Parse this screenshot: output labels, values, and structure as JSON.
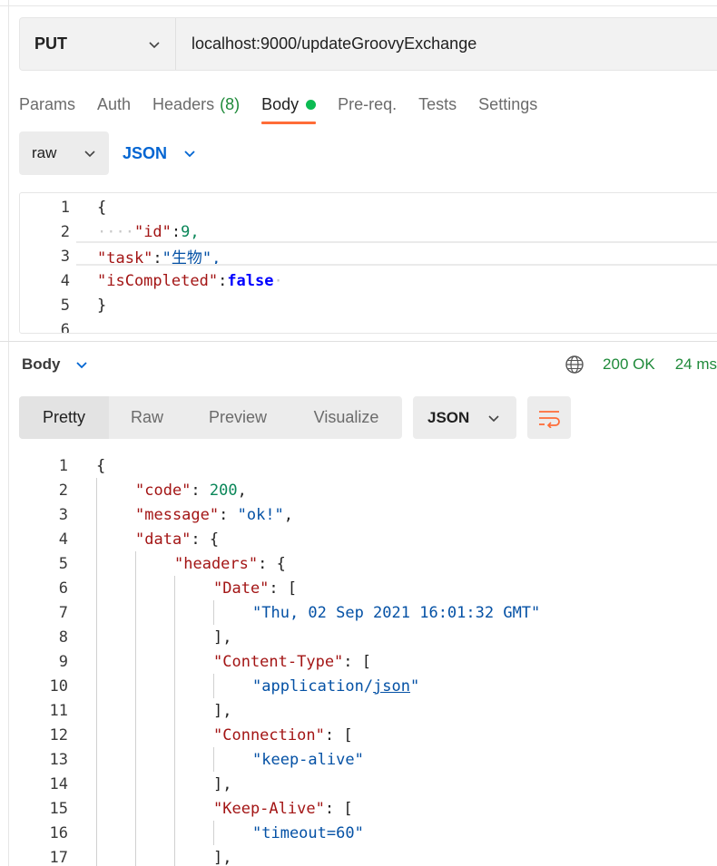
{
  "request": {
    "method": "PUT",
    "url": "localhost:9000/updateGroovyExchange",
    "tabs": [
      {
        "label": "Params"
      },
      {
        "label": "Auth"
      },
      {
        "label": "Headers",
        "count": "(8)"
      },
      {
        "label": "Body"
      },
      {
        "label": "Pre-req."
      },
      {
        "label": "Tests"
      },
      {
        "label": "Settings"
      }
    ],
    "body_mode": "raw",
    "body_format": "JSON",
    "body_lines": [
      {
        "num": "1",
        "text": "{"
      },
      {
        "num": "2",
        "key": "\"id\"",
        "value": "9,"
      },
      {
        "num": "3",
        "key": "\"task\"",
        "value": "\"生物\","
      },
      {
        "num": "4",
        "key": "\"isCompleted\"",
        "value": "false"
      },
      {
        "num": "5",
        "text": "}"
      },
      {
        "num": "6",
        "text": ""
      }
    ]
  },
  "response": {
    "label": "Body",
    "status": "200 OK",
    "time": "24 ms",
    "view_tabs": [
      "Pretty",
      "Raw",
      "Preview",
      "Visualize"
    ],
    "format": "JSON",
    "lines": [
      {
        "num": "1",
        "text": "{"
      },
      {
        "num": "2",
        "key": "\"code\"",
        "value": "200",
        "tail": ","
      },
      {
        "num": "3",
        "key": "\"message\"",
        "value": "\"ok!\"",
        "tail": ","
      },
      {
        "num": "4",
        "key": "\"data\"",
        "tail": "{"
      },
      {
        "num": "5",
        "key": "\"headers\"",
        "tail": "{"
      },
      {
        "num": "6",
        "key": "\"Date\"",
        "tail": "["
      },
      {
        "num": "7",
        "value": "\"Thu, 02 Sep 2021 16:01:32 GMT\""
      },
      {
        "num": "8",
        "text": "],"
      },
      {
        "num": "9",
        "key": "\"Content-Type\"",
        "tail": "["
      },
      {
        "num": "10",
        "value_a": "\"application/",
        "value_b": "json",
        "value_c": "\""
      },
      {
        "num": "11",
        "text": "],"
      },
      {
        "num": "12",
        "key": "\"Connection\"",
        "tail": "["
      },
      {
        "num": "13",
        "value": "\"keep-alive\""
      },
      {
        "num": "14",
        "text": "],"
      },
      {
        "num": "15",
        "key": "\"Keep-Alive\"",
        "tail": "["
      },
      {
        "num": "16",
        "value": "\"timeout=60\""
      },
      {
        "num": "17",
        "text": "],"
      }
    ]
  },
  "colors": {
    "accent": "#ff6c37",
    "success": "#1f8a3a",
    "link": "#0265d2",
    "json_key": "#a31515",
    "json_string": "#0451a5",
    "json_number": "#098658"
  }
}
